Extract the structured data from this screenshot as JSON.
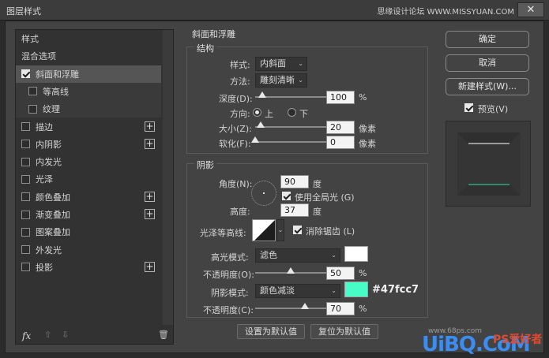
{
  "window": {
    "title": "图层样式",
    "watermark": "思缘设计论坛 WWW.MISSYUAN.COM",
    "close": "✕"
  },
  "left": {
    "items": [
      {
        "label": "样式",
        "checkbox": false,
        "checked": false,
        "plus": false,
        "sub": false,
        "active": false
      },
      {
        "label": "混合选项",
        "checkbox": false,
        "checked": false,
        "plus": false,
        "sub": false,
        "active": false
      },
      {
        "label": "斜面和浮雕",
        "checkbox": true,
        "checked": true,
        "plus": false,
        "sub": false,
        "active": true
      },
      {
        "label": "等高线",
        "checkbox": true,
        "checked": false,
        "plus": false,
        "sub": true,
        "active": false
      },
      {
        "label": "纹理",
        "checkbox": true,
        "checked": false,
        "plus": false,
        "sub": true,
        "active": false
      },
      {
        "label": "描边",
        "checkbox": true,
        "checked": false,
        "plus": true,
        "sub": false,
        "active": false
      },
      {
        "label": "内阴影",
        "checkbox": true,
        "checked": false,
        "plus": true,
        "sub": false,
        "active": false
      },
      {
        "label": "内发光",
        "checkbox": true,
        "checked": false,
        "plus": false,
        "sub": false,
        "active": false
      },
      {
        "label": "光泽",
        "checkbox": true,
        "checked": false,
        "plus": false,
        "sub": false,
        "active": false
      },
      {
        "label": "颜色叠加",
        "checkbox": true,
        "checked": false,
        "plus": true,
        "sub": false,
        "active": false
      },
      {
        "label": "渐变叠加",
        "checkbox": true,
        "checked": false,
        "plus": true,
        "sub": false,
        "active": false
      },
      {
        "label": "图案叠加",
        "checkbox": true,
        "checked": false,
        "plus": false,
        "sub": false,
        "active": false
      },
      {
        "label": "外发光",
        "checkbox": true,
        "checked": false,
        "plus": false,
        "sub": false,
        "active": false
      },
      {
        "label": "投影",
        "checkbox": true,
        "checked": false,
        "plus": true,
        "sub": false,
        "active": false
      }
    ],
    "footer": {
      "fx": "fx",
      "up": "⇧",
      "down": "⇩",
      "trash": "🗑"
    }
  },
  "bevel": {
    "section_title": "斜面和浮雕",
    "structure": {
      "title": "结构",
      "style_label": "样式:",
      "style_value": "内斜面",
      "technique_label": "方法:",
      "technique_value": "雕刻清晰",
      "depth_label": "深度(D):",
      "depth_value": "100",
      "depth_unit": "%",
      "depth_fraction": 0.1,
      "direction_label": "方向:",
      "direction_up": "上",
      "direction_down": "下",
      "size_label": "大小(Z):",
      "size_value": "20",
      "size_unit": "像素",
      "size_fraction": 0.08,
      "soften_label": "软化(F):",
      "soften_value": "0",
      "soften_unit": "像素",
      "soften_fraction": 0.0
    },
    "shading": {
      "title": "阴影",
      "angle_label": "角度(N):",
      "angle_value": "90",
      "angle_unit": "度",
      "global_light_label": "使用全局光 (G)",
      "altitude_label": "高度:",
      "altitude_value": "37",
      "altitude_unit": "度",
      "gloss_label": "光泽等高线:",
      "antialias_label": "消除锯齿 (L)",
      "highlight_label": "高光模式:",
      "highlight_mode": "滤色",
      "highlight_color": "#ffffff",
      "highlight_opacity_label": "不透明度(O):",
      "highlight_opacity": "50",
      "highlight_opacity_unit": "%",
      "highlight_fraction": 0.5,
      "shadow_label": "阴影模式:",
      "shadow_mode": "颜色减淡",
      "shadow_color": "#47fcc7",
      "shadow_hex": "#47fcc7",
      "shadow_opacity_label": "不透明度(C):",
      "shadow_opacity": "70",
      "shadow_opacity_unit": "%",
      "shadow_fraction": 0.7
    },
    "buttons": {
      "set_default": "设置为默认值",
      "reset_default": "复位为默认值"
    }
  },
  "right": {
    "ok": "确定",
    "cancel": "取消",
    "new_style": "新建样式(W)...",
    "preview_label": "预览(V)"
  },
  "site": {
    "wm": "www.68ps.com",
    "logo": "UiBQ.CoM",
    "logo_suffix": "PS爱好者"
  }
}
